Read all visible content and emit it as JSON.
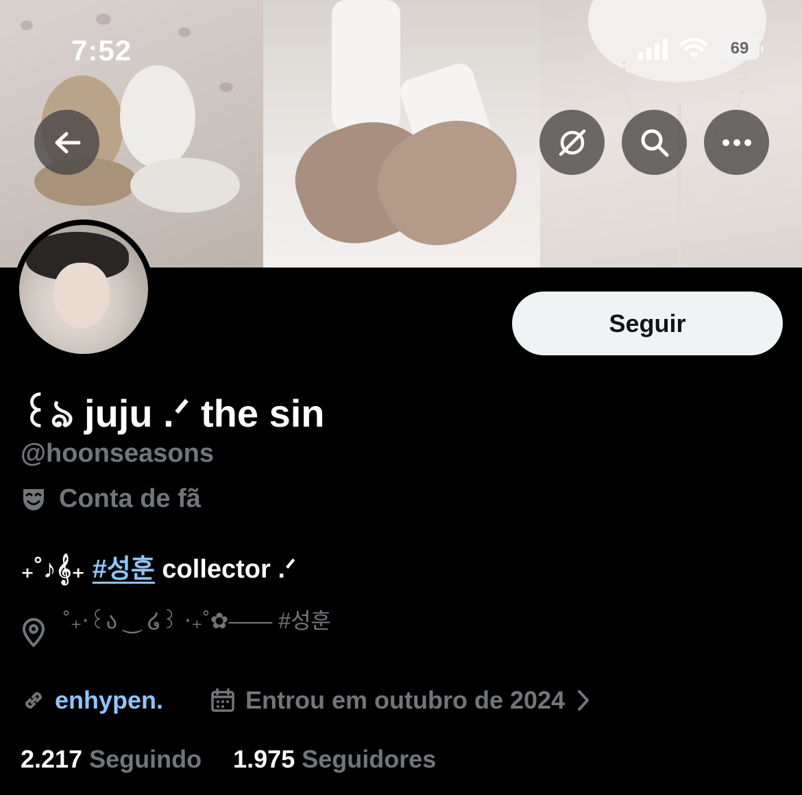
{
  "status_bar": {
    "time": "7:52",
    "battery": "69"
  },
  "icons": {
    "back": "back-arrow-icon",
    "grok": "grok-icon",
    "search": "search-icon",
    "more": "more-dots-icon",
    "fan_account": "theater-mask-icon",
    "location": "location-pin-icon",
    "link": "link-icon",
    "calendar": "calendar-icon",
    "chevron": "chevron-right-icon"
  },
  "profile": {
    "follow_label": "Seguir",
    "display_name": "꒰ঌ juju .ᐟ the sin",
    "handle": "@hoonseasons",
    "account_label": "Conta de fã",
    "bio_prefix": "₊˚♪𝄞₊ ",
    "bio_hashtag": "#성훈",
    "bio_suffix": " collector .ᐟ",
    "location": "˚₊‧꒰ა ‿ ໒꒱ ‧₊˚✿—— #성훈",
    "website": "enhypen.",
    "joined": "Entrou em outubro de 2024",
    "following_count": "2.217",
    "following_label": "Seguindo",
    "followers_count": "1.975",
    "followers_label": "Seguidores"
  },
  "colors": {
    "link": "#8ec5fb",
    "muted": "#71767b",
    "background": "#000000",
    "button_bg": "#eff3f4"
  }
}
